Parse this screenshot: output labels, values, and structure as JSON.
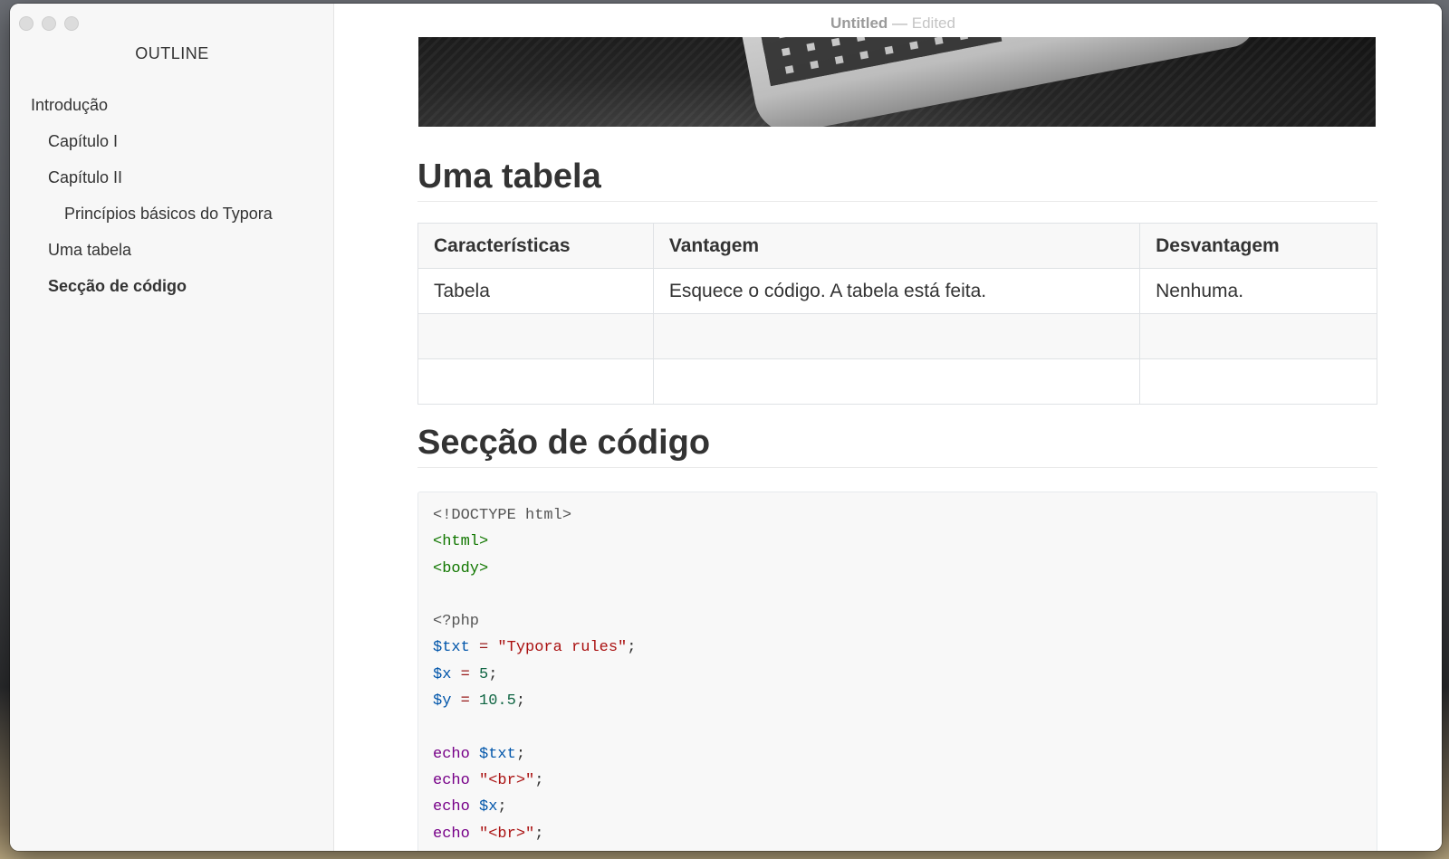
{
  "window": {
    "title": "Untitled",
    "title_separator": "—",
    "status": "Edited"
  },
  "sidebar": {
    "heading": "OUTLINE",
    "items": [
      {
        "label": "Introdução",
        "level": 1
      },
      {
        "label": "Capítulo I",
        "level": 2
      },
      {
        "label": "Capítulo II",
        "level": 2
      },
      {
        "label": "Princípios básicos do Typora",
        "level": 3
      },
      {
        "label": "Uma tabela",
        "level": 2
      },
      {
        "label": "Secção de código",
        "level": 2,
        "active": true
      }
    ]
  },
  "document": {
    "table_heading": "Uma tabela",
    "table": {
      "headers": [
        "Características",
        "Vantagem",
        "Desvantagem"
      ],
      "rows": [
        [
          "Tabela",
          "Esquece o código. A tabela está feita.",
          "Nenhuma."
        ],
        [
          "",
          "",
          ""
        ],
        [
          "",
          "",
          ""
        ]
      ]
    },
    "code_heading": "Secção de código",
    "code": {
      "l1": "<!DOCTYPE html>",
      "l2": "<html>",
      "l3": "<body>",
      "l5": "<?php",
      "l6_var": "$txt",
      "l6_op": " = ",
      "l6_str": "\"Typora rules\"",
      "l6_end": ";",
      "l7_var": "$x",
      "l7_op": " = ",
      "l7_num": "5",
      "l7_end": ";",
      "l8_var": "$y",
      "l8_op": " = ",
      "l8_num": "10.5",
      "l8_end": ";",
      "echo": "echo",
      "l10_var": "$txt",
      "l11_str": "\"<br>\"",
      "l12_var": "$x",
      "l13_str": "\"<br>\"",
      "semicolon": ";"
    }
  },
  "colors": {
    "code_tag": "#117700",
    "code_var": "#0055aa",
    "code_string": "#aa1111",
    "code_number": "#116644",
    "code_keyword": "#770088"
  }
}
